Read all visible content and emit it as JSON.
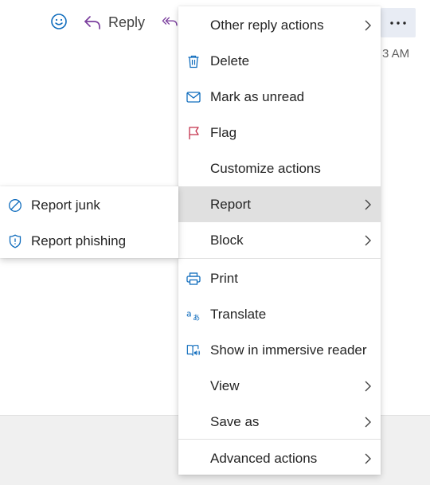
{
  "toolbar": {
    "emoji_icon": "emoji-icon",
    "reply_label": "Reply",
    "reply_icon": "reply-arrow-icon",
    "reply_all_icon": "reply-all-icon",
    "more_icon": "more-ellipsis-icon",
    "time_partial": "3 AM"
  },
  "main_menu": {
    "items": [
      {
        "label": "Other reply actions",
        "icon": null,
        "submenu": true
      },
      {
        "label": "Delete",
        "icon": "trash-icon"
      },
      {
        "label": "Mark as unread",
        "icon": "envelope-icon"
      },
      {
        "label": "Flag",
        "icon": "flag-icon"
      },
      {
        "label": "Customize actions",
        "icon": null
      },
      {
        "label": "Report",
        "icon": null,
        "submenu": true,
        "highlighted": true
      },
      {
        "label": "Block",
        "icon": null,
        "submenu": true
      },
      {
        "label": "Print",
        "icon": "printer-icon"
      },
      {
        "label": "Translate",
        "icon": "translate-icon"
      },
      {
        "label": "Show in immersive reader",
        "icon": "immersive-reader-icon"
      },
      {
        "label": "View",
        "icon": null,
        "submenu": true
      },
      {
        "label": "Save as",
        "icon": null,
        "submenu": true
      },
      {
        "label": "Advanced actions",
        "icon": null,
        "submenu": true
      }
    ]
  },
  "report_submenu": {
    "items": [
      {
        "label": "Report junk",
        "icon": "junk-circle-slash-icon"
      },
      {
        "label": "Report phishing",
        "icon": "shield-icon"
      }
    ]
  },
  "colors": {
    "accent_blue": "#0f6cbd",
    "flag_red": "#c4314b",
    "reply_purple": "#7b3f9e",
    "highlight": "#e0e0e0",
    "more_button_bg": "#e8ecf4"
  }
}
